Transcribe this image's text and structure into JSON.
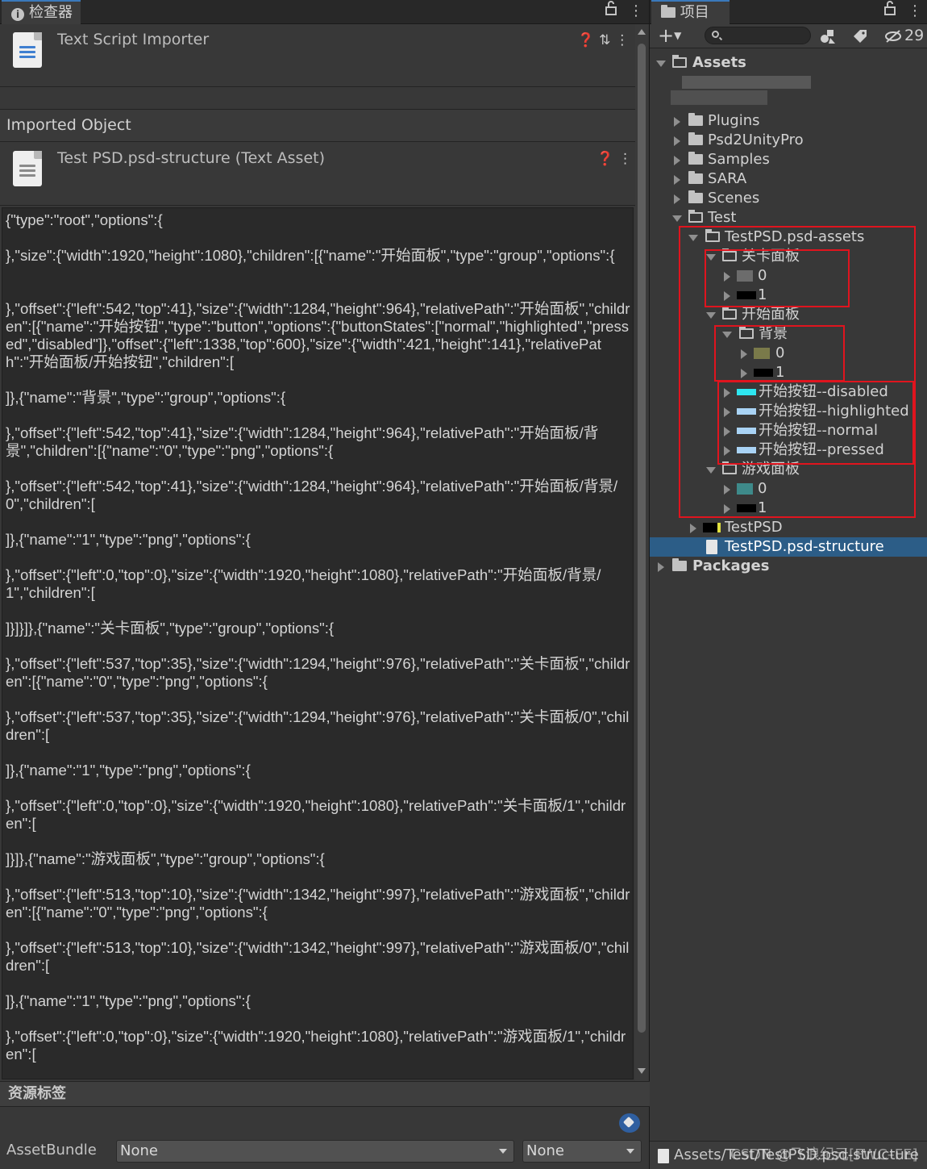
{
  "inspector": {
    "tab_title": "检查器",
    "importer_title": "Text Script Importer",
    "imported_object_label": "Imported Object",
    "asset_title": "Test PSD.psd-structure (Text Asset)",
    "text_lines": [
      "{\"type\":\"root\",\"options\":{",
      "},\"size\":{\"width\":1920,\"height\":1080},\"children\":[{\"name\":\"开始面板\",\"type\":\"group\",\"options\":{",
      "},\"offset\":{\"left\":542,\"top\":41},\"size\":{\"width\":1284,\"height\":964},\"relativePath\":\"开始面板\",\"children\":[{\"name\":\"开始按钮\",\"type\":\"button\",\"options\":{\"buttonStates\":[\"normal\",\"highlighted\",\"pressed\",\"disabled\"]},\"offset\":{\"left\":1338,\"top\":600},\"size\":{\"width\":421,\"height\":141},\"relativePath\":\"开始面板/开始按钮\",\"children\":[",
      "]},{\"name\":\"背景\",\"type\":\"group\",\"options\":{",
      "},\"offset\":{\"left\":542,\"top\":41},\"size\":{\"width\":1284,\"height\":964},\"relativePath\":\"开始面板/背景\",\"children\":[{\"name\":\"0\",\"type\":\"png\",\"options\":{",
      "},\"offset\":{\"left\":542,\"top\":41},\"size\":{\"width\":1284,\"height\":964},\"relativePath\":\"开始面板/背景/0\",\"children\":[",
      "]},{\"name\":\"1\",\"type\":\"png\",\"options\":{",
      "},\"offset\":{\"left\":0,\"top\":0},\"size\":{\"width\":1920,\"height\":1080},\"relativePath\":\"开始面板/背景/1\",\"children\":[",
      "]}]}]},{\"name\":\"关卡面板\",\"type\":\"group\",\"options\":{",
      "},\"offset\":{\"left\":537,\"top\":35},\"size\":{\"width\":1294,\"height\":976},\"relativePath\":\"关卡面板\",\"children\":[{\"name\":\"0\",\"type\":\"png\",\"options\":{",
      "},\"offset\":{\"left\":537,\"top\":35},\"size\":{\"width\":1294,\"height\":976},\"relativePath\":\"关卡面板/0\",\"children\":[",
      "]},{\"name\":\"1\",\"type\":\"png\",\"options\":{",
      "},\"offset\":{\"left\":0,\"top\":0},\"size\":{\"width\":1920,\"height\":1080},\"relativePath\":\"关卡面板/1\",\"children\":[",
      "]}]},{\"name\":\"游戏面板\",\"type\":\"group\",\"options\":{",
      "},\"offset\":{\"left\":513,\"top\":10},\"size\":{\"width\":1342,\"height\":997},\"relativePath\":\"游戏面板\",\"children\":[{\"name\":\"0\",\"type\":\"png\",\"options\":{",
      "},\"offset\":{\"left\":513,\"top\":10},\"size\":{\"width\":1342,\"height\":997},\"relativePath\":\"游戏面板/0\",\"children\":[",
      "]},{\"name\":\"1\",\"type\":\"png\",\"options\":{",
      "},\"offset\":{\"left\":0,\"top\":0},\"size\":{\"width\":1920,\"height\":1080},\"relativePath\":\"游戏面板/1\",\"children\":["
    ],
    "labels_section": "资源标签",
    "assetbundle_label": "AssetBundle",
    "assetbundle_name": "None",
    "assetbundle_variant": "None"
  },
  "project": {
    "tab_title": "项目",
    "hidden_count": "29",
    "footer_path": "Assets/Test/TestPSD.psd-structure",
    "watermark": "CSDN @飞浪纪元[FWC–FE]",
    "tree": [
      {
        "label": "Assets",
        "kind": "folder-open",
        "expanded": true
      },
      {
        "label": "Plugins",
        "kind": "folder",
        "expanded": false
      },
      {
        "label": "Psd2UnityPro",
        "kind": "folder",
        "expanded": false
      },
      {
        "label": "Samples",
        "kind": "folder",
        "expanded": false
      },
      {
        "label": "SARA",
        "kind": "folder",
        "expanded": false
      },
      {
        "label": "Scenes",
        "kind": "folder",
        "expanded": false
      },
      {
        "label": "Test",
        "kind": "folder-open",
        "expanded": true
      },
      {
        "label": "TestPSD.psd-assets",
        "kind": "folder-open",
        "expanded": true
      },
      {
        "label": "关卡面板",
        "kind": "folder-open",
        "expanded": true
      },
      {
        "label": "0",
        "kind": "sprite",
        "expanded": false
      },
      {
        "label": "1",
        "kind": "sprite-black",
        "expanded": false
      },
      {
        "label": "开始面板",
        "kind": "folder-open",
        "expanded": true
      },
      {
        "label": "背景",
        "kind": "folder-open",
        "expanded": true
      },
      {
        "label": "0",
        "kind": "sprite",
        "expanded": false
      },
      {
        "label": "1",
        "kind": "sprite-black",
        "expanded": false
      },
      {
        "label": "开始按钮--disabled",
        "kind": "sprite-cyan",
        "expanded": false
      },
      {
        "label": "开始按钮--highlighted",
        "kind": "sprite-light",
        "expanded": false
      },
      {
        "label": "开始按钮--normal",
        "kind": "sprite-light",
        "expanded": false
      },
      {
        "label": "开始按钮--pressed",
        "kind": "sprite-light",
        "expanded": false
      },
      {
        "label": "游戏面板",
        "kind": "folder-open",
        "expanded": true
      },
      {
        "label": "0",
        "kind": "sprite-teal",
        "expanded": false
      },
      {
        "label": "1",
        "kind": "sprite-black",
        "expanded": false
      },
      {
        "label": "TestPSD",
        "kind": "prefab",
        "expanded": false
      },
      {
        "label": "TestPSD.psd-structure",
        "kind": "textasset",
        "expanded": false,
        "selected": true
      },
      {
        "label": "Packages",
        "kind": "folder",
        "expanded": false
      }
    ]
  },
  "colors": {
    "panel_bg": "#383838",
    "text_area_bg": "#2a2a2a",
    "selection": "#2c5d87",
    "tab_accent": "#3a79bb",
    "highlight_box": "#e0141e",
    "swatch_cyan": "#2ee6f0",
    "swatch_light": "#a9d3f5"
  }
}
